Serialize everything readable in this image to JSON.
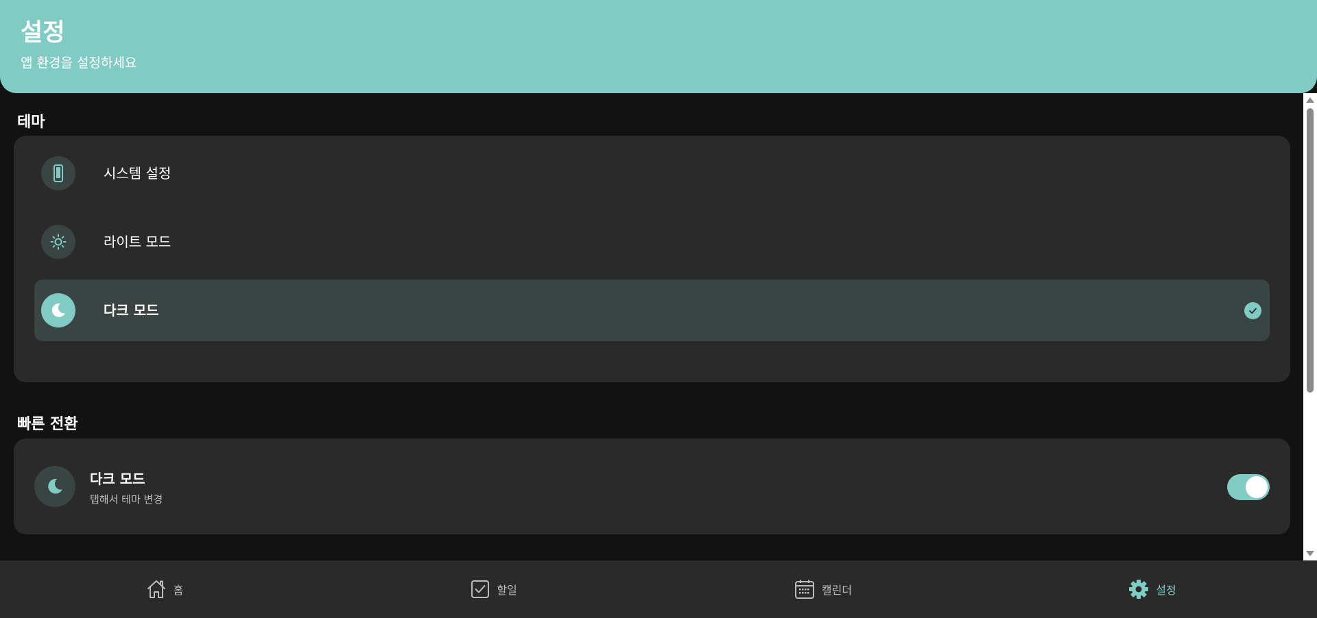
{
  "header": {
    "title": "설정",
    "subtitle": "앱 환경을 설정하세요"
  },
  "theme_section": {
    "title": "테마",
    "options": [
      {
        "label": "시스템 설정",
        "icon": "phone-icon",
        "selected": false
      },
      {
        "label": "라이트 모드",
        "icon": "sun-icon",
        "selected": false
      },
      {
        "label": "다크 모드",
        "icon": "moon-icon",
        "selected": true
      }
    ]
  },
  "quick_section": {
    "title": "빠른 전환",
    "item": {
      "title": "다크 모드",
      "subtitle": "탭해서 테마 변경",
      "icon": "moon-icon",
      "toggle_on": true
    }
  },
  "bottom_nav": {
    "items": [
      {
        "label": "홈",
        "icon": "home-icon",
        "active": false
      },
      {
        "label": "할일",
        "icon": "checkbox-icon",
        "active": false
      },
      {
        "label": "캘린더",
        "icon": "calendar-icon",
        "active": false
      },
      {
        "label": "설정",
        "icon": "gear-icon",
        "active": true
      }
    ]
  },
  "colors": {
    "accent": "#80cbc4",
    "background": "#121212",
    "card": "#2a2a2a",
    "selected": "#3a4443"
  }
}
